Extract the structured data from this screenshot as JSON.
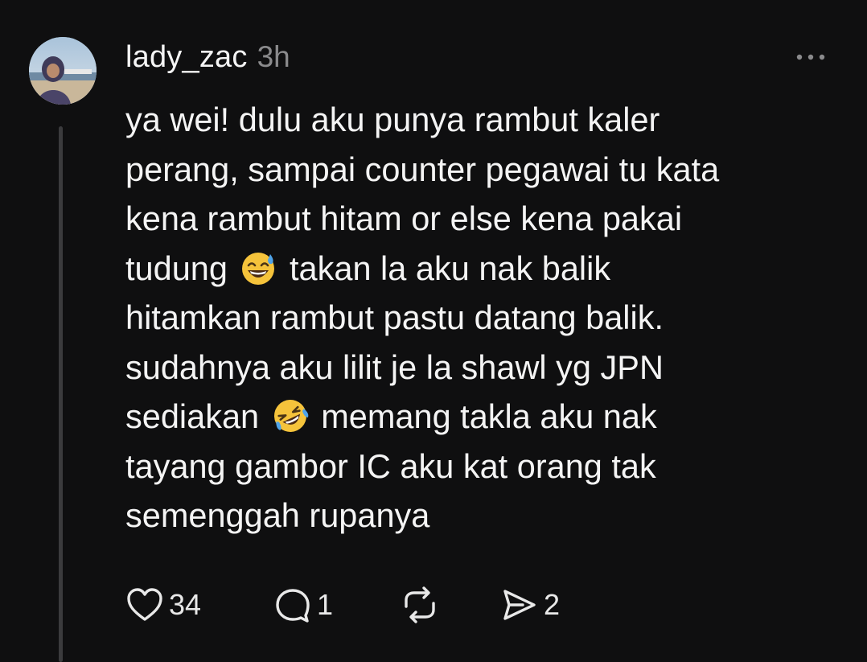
{
  "post": {
    "username": "lady_zac",
    "time": "3h",
    "body_lines": [
      "ya wei! dulu aku punya rambut kaler",
      "perang, sampai counter pegawai tu kata",
      "kena rambut hitam or else kena pakai",
      [
        "tudung",
        "takan la aku nak balik"
      ],
      "hitamkan rambut pastu datang balik.",
      "sudahnya aku lilit je la shawl yg JPN",
      [
        "sediakan",
        "memang takla aku nak"
      ],
      "tayang gambor IC aku kat orang tak",
      "semenggah rupanya"
    ],
    "emojis": [
      "grinning-sweat-emoji",
      "rolling-laughing-emoji"
    ]
  },
  "actions": {
    "likes": "34",
    "replies": "1",
    "shares": "2"
  },
  "icons": {
    "more": "more-horizontal-icon",
    "like": "heart-icon",
    "reply": "comment-icon",
    "repost": "repost-icon",
    "share": "send-icon"
  },
  "colors": {
    "background": "#0f0f10",
    "text": "#f4f4f4",
    "muted": "#8a8a8c",
    "thread_line": "#3b3b3d"
  }
}
